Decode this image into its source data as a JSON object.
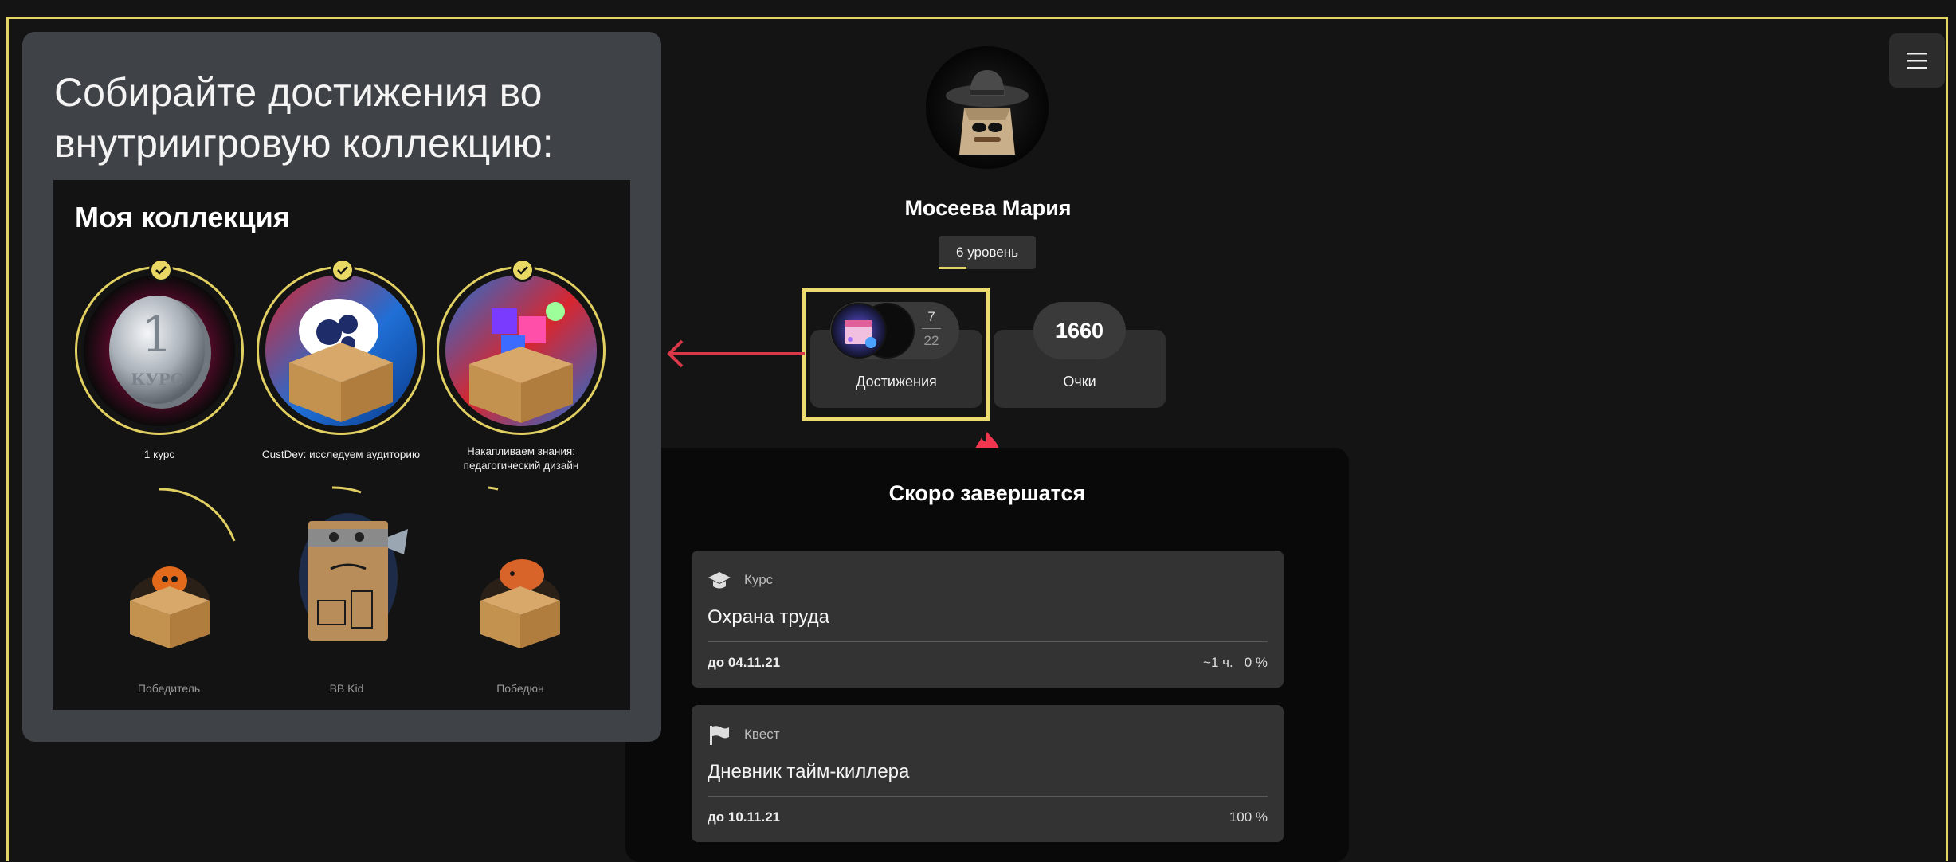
{
  "overlay": {
    "heading": "Собирайте достижения во внутриигровую коллекцию:",
    "collection": {
      "title": "Моя коллекция",
      "earned": [
        {
          "label": "1 курс",
          "icon": "coin-icon"
        },
        {
          "label": "CustDev: исследуем аудиторию",
          "icon": "box-gears-icon"
        },
        {
          "label": "Накапливаем знания: педагогический дизайн",
          "icon": "box-blocks-icon"
        }
      ],
      "locked": [
        {
          "label": "Победитель",
          "icon": "box-cat-icon"
        },
        {
          "label": "BB Kid",
          "icon": "box-character-icon"
        },
        {
          "label": "Победюн",
          "icon": "box-squirrel-icon"
        }
      ],
      "earned_icon_text": "1",
      "earned_icon_subtext": "КУРС"
    }
  },
  "profile": {
    "name": "Мосеева Мария",
    "level": "6 уровень",
    "level_progress": 0.29
  },
  "achievements": {
    "earned": "7",
    "total": "22",
    "label": "Достижения"
  },
  "points": {
    "value": "1660",
    "label": "Очки"
  },
  "soon": {
    "title": "Скоро завершатся",
    "tasks": [
      {
        "type": "Курс",
        "title": "Охрана труда",
        "due": "до 04.11.21",
        "time": "~1 ч.",
        "progress": "0 %",
        "icon": "graduation-cap-icon"
      },
      {
        "type": "Квест",
        "title": "Дневник тайм-киллера",
        "due": "до 10.11.21",
        "time": "",
        "progress": "100 %",
        "icon": "flag-icon"
      }
    ]
  },
  "colors": {
    "highlight": "#ecdb6e",
    "arrow": "#d83848",
    "accent": "#e4d468",
    "fire": "#f0354f"
  }
}
